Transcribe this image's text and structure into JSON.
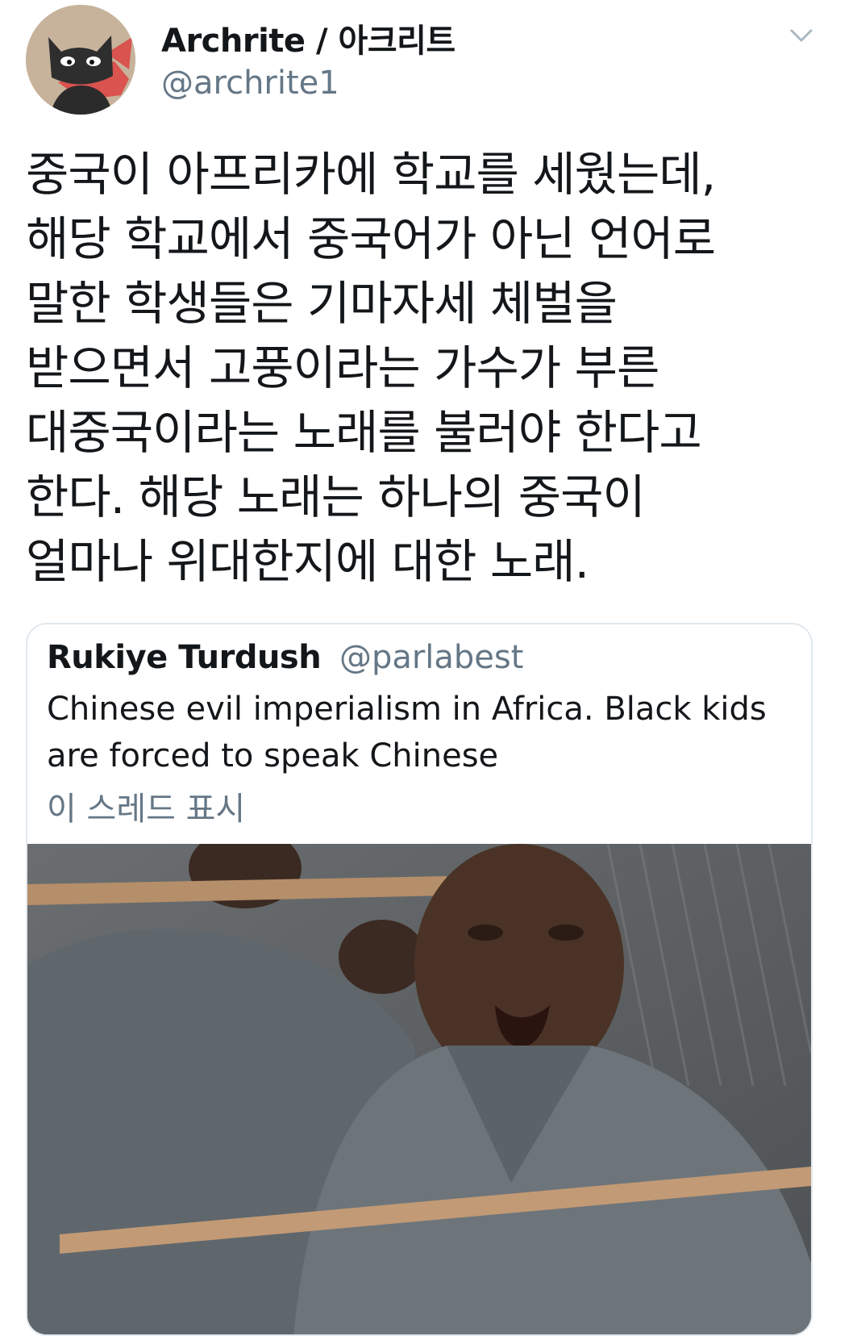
{
  "tweet": {
    "author": {
      "display_name": "Archrite / 아크리트",
      "handle": "@archrite1"
    },
    "menu_icon": "chevron-down-icon",
    "text_lines": [
      "중국이 아프리카에 학교를 세웠는데,",
      "해당 학교에서 중국어가 아닌 언어로",
      "말한 학생들은 기마자세 체벌을",
      "받으면서 고풍이라는 가수가 부른",
      "대중국이라는 노래를 불러야 한다고",
      "한다. 해당 노래는 하나의 중국이",
      "얼마나 위대한지에 대한 노래."
    ]
  },
  "quoted_tweet": {
    "display_name": "Rukiye Turdush",
    "handle": "@parlabest",
    "text_lines": [
      "Chinese evil imperialism in Africa. Black kids",
      "are forced to speak Chinese"
    ],
    "show_thread_label": "이 스레드 표시"
  },
  "colors": {
    "text_primary": "#14171a",
    "text_secondary": "#657786",
    "border": "#e1e8ed"
  }
}
